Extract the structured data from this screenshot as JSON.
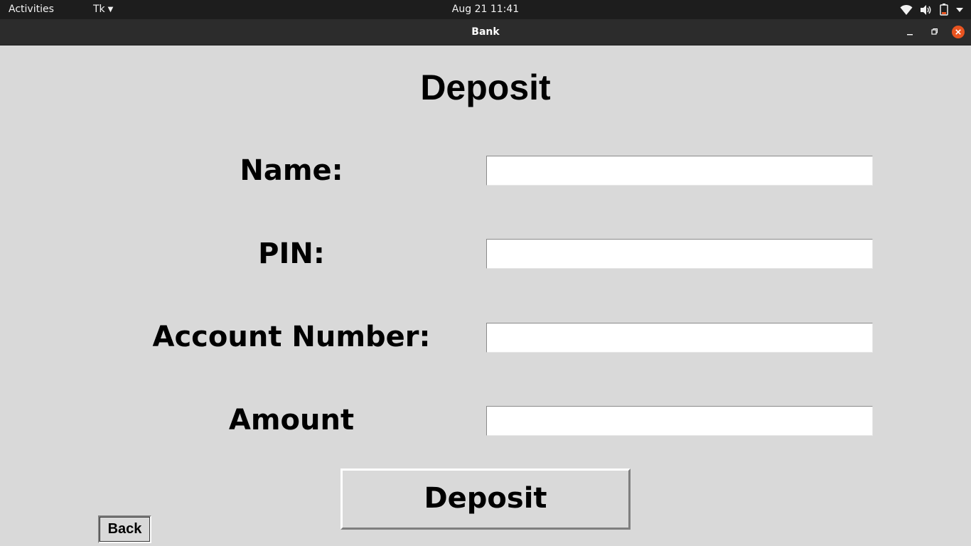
{
  "topbar": {
    "activities": "Activities",
    "app_menu": "Tk",
    "clock": "Aug 21  11:41",
    "icons": [
      "wifi-icon",
      "volume-icon",
      "battery-icon",
      "system-menu-icon"
    ]
  },
  "window": {
    "title": "Bank",
    "controls": [
      "minimize-icon",
      "maximize-icon",
      "close-icon"
    ],
    "close_color": "#e95420"
  },
  "form": {
    "heading": "Deposit",
    "fields": [
      {
        "label": "Name:",
        "value": ""
      },
      {
        "label": "PIN:",
        "value": ""
      },
      {
        "label": "Account Number:",
        "value": ""
      },
      {
        "label": "Amount",
        "value": ""
      }
    ],
    "submit_label": "Deposit",
    "back_label": "Back"
  }
}
